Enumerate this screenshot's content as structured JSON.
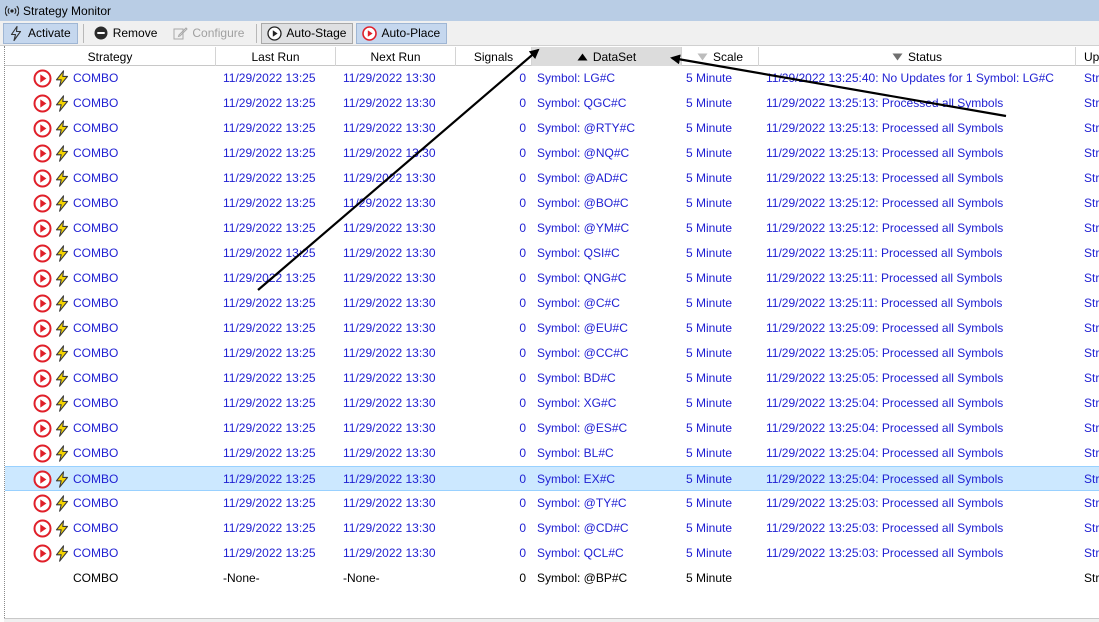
{
  "window": {
    "title": "Strategy Monitor"
  },
  "toolbar": {
    "activate": "Activate",
    "remove": "Remove",
    "configure": "Configure",
    "auto_stage": "Auto-Stage",
    "auto_place": "Auto-Place"
  },
  "columns": {
    "strategy": "Strategy",
    "last_run": "Last Run",
    "next_run": "Next Run",
    "signals": "Signals",
    "dataset": "DataSet",
    "scale": "Scale",
    "status": "Status",
    "up": "Up"
  },
  "rows": [
    {
      "strategy": "COMBO",
      "last_run": "11/29/2022 13:25",
      "next_run": "11/29/2022 13:30",
      "signals": "0",
      "dataset": "Symbol: LG#C",
      "scale": "5 Minute",
      "status": "11/29/2022 13:25:40: No Updates for 1 Symbol: LG#C",
      "up": "Str"
    },
    {
      "strategy": "COMBO",
      "last_run": "11/29/2022 13:25",
      "next_run": "11/29/2022 13:30",
      "signals": "0",
      "dataset": "Symbol: QGC#C",
      "scale": "5 Minute",
      "status": "11/29/2022 13:25:13: Processed all Symbols",
      "up": "Str"
    },
    {
      "strategy": "COMBO",
      "last_run": "11/29/2022 13:25",
      "next_run": "11/29/2022 13:30",
      "signals": "0",
      "dataset": "Symbol: @RTY#C",
      "scale": "5 Minute",
      "status": "11/29/2022 13:25:13: Processed all Symbols",
      "up": "Str"
    },
    {
      "strategy": "COMBO",
      "last_run": "11/29/2022 13:25",
      "next_run": "11/29/2022 13:30",
      "signals": "0",
      "dataset": "Symbol: @NQ#C",
      "scale": "5 Minute",
      "status": "11/29/2022 13:25:13: Processed all Symbols",
      "up": "Str"
    },
    {
      "strategy": "COMBO",
      "last_run": "11/29/2022 13:25",
      "next_run": "11/29/2022 13:30",
      "signals": "0",
      "dataset": "Symbol: @AD#C",
      "scale": "5 Minute",
      "status": "11/29/2022 13:25:13: Processed all Symbols",
      "up": "Str"
    },
    {
      "strategy": "COMBO",
      "last_run": "11/29/2022 13:25",
      "next_run": "11/29/2022 13:30",
      "signals": "0",
      "dataset": "Symbol: @BO#C",
      "scale": "5 Minute",
      "status": "11/29/2022 13:25:12: Processed all Symbols",
      "up": "Str"
    },
    {
      "strategy": "COMBO",
      "last_run": "11/29/2022 13:25",
      "next_run": "11/29/2022 13:30",
      "signals": "0",
      "dataset": "Symbol: @YM#C",
      "scale": "5 Minute",
      "status": "11/29/2022 13:25:12: Processed all Symbols",
      "up": "Str"
    },
    {
      "strategy": "COMBO",
      "last_run": "11/29/2022 13:25",
      "next_run": "11/29/2022 13:30",
      "signals": "0",
      "dataset": "Symbol: QSI#C",
      "scale": "5 Minute",
      "status": "11/29/2022 13:25:11: Processed all Symbols",
      "up": "Str"
    },
    {
      "strategy": "COMBO",
      "last_run": "11/29/2022 13:25",
      "next_run": "11/29/2022 13:30",
      "signals": "0",
      "dataset": "Symbol: QNG#C",
      "scale": "5 Minute",
      "status": "11/29/2022 13:25:11: Processed all Symbols",
      "up": "Str"
    },
    {
      "strategy": "COMBO",
      "last_run": "11/29/2022 13:25",
      "next_run": "11/29/2022 13:30",
      "signals": "0",
      "dataset": "Symbol: @C#C",
      "scale": "5 Minute",
      "status": "11/29/2022 13:25:11: Processed all Symbols",
      "up": "Str"
    },
    {
      "strategy": "COMBO",
      "last_run": "11/29/2022 13:25",
      "next_run": "11/29/2022 13:30",
      "signals": "0",
      "dataset": "Symbol: @EU#C",
      "scale": "5 Minute",
      "status": "11/29/2022 13:25:09: Processed all Symbols",
      "up": "Str"
    },
    {
      "strategy": "COMBO",
      "last_run": "11/29/2022 13:25",
      "next_run": "11/29/2022 13:30",
      "signals": "0",
      "dataset": "Symbol: @CC#C",
      "scale": "5 Minute",
      "status": "11/29/2022 13:25:05: Processed all Symbols",
      "up": "Str"
    },
    {
      "strategy": "COMBO",
      "last_run": "11/29/2022 13:25",
      "next_run": "11/29/2022 13:30",
      "signals": "0",
      "dataset": "Symbol: BD#C",
      "scale": "5 Minute",
      "status": "11/29/2022 13:25:05: Processed all Symbols",
      "up": "Str"
    },
    {
      "strategy": "COMBO",
      "last_run": "11/29/2022 13:25",
      "next_run": "11/29/2022 13:30",
      "signals": "0",
      "dataset": "Symbol: XG#C",
      "scale": "5 Minute",
      "status": "11/29/2022 13:25:04: Processed all Symbols",
      "up": "Str"
    },
    {
      "strategy": "COMBO",
      "last_run": "11/29/2022 13:25",
      "next_run": "11/29/2022 13:30",
      "signals": "0",
      "dataset": "Symbol: @ES#C",
      "scale": "5 Minute",
      "status": "11/29/2022 13:25:04: Processed all Symbols",
      "up": "Str"
    },
    {
      "strategy": "COMBO",
      "last_run": "11/29/2022 13:25",
      "next_run": "11/29/2022 13:30",
      "signals": "0",
      "dataset": "Symbol: BL#C",
      "scale": "5 Minute",
      "status": "11/29/2022 13:25:04: Processed all Symbols",
      "up": "Str"
    },
    {
      "strategy": "COMBO",
      "last_run": "11/29/2022 13:25",
      "next_run": "11/29/2022 13:30",
      "signals": "0",
      "dataset": "Symbol: EX#C",
      "scale": "5 Minute",
      "status": "11/29/2022 13:25:04: Processed all Symbols",
      "up": "Str"
    },
    {
      "strategy": "COMBO",
      "last_run": "11/29/2022 13:25",
      "next_run": "11/29/2022 13:30",
      "signals": "0",
      "dataset": "Symbol: @TY#C",
      "scale": "5 Minute",
      "status": "11/29/2022 13:25:03: Processed all Symbols",
      "up": "Str"
    },
    {
      "strategy": "COMBO",
      "last_run": "11/29/2022 13:25",
      "next_run": "11/29/2022 13:30",
      "signals": "0",
      "dataset": "Symbol: @CD#C",
      "scale": "5 Minute",
      "status": "11/29/2022 13:25:03: Processed all Symbols",
      "up": "Str"
    },
    {
      "strategy": "COMBO",
      "last_run": "11/29/2022 13:25",
      "next_run": "11/29/2022 13:30",
      "signals": "0",
      "dataset": "Symbol: QCL#C",
      "scale": "5 Minute",
      "status": "11/29/2022 13:25:03: Processed all Symbols",
      "up": "Str"
    },
    {
      "strategy": "COMBO",
      "last_run": "-None-",
      "next_run": "-None-",
      "signals": "0",
      "dataset": "Symbol: @BP#C",
      "scale": "5 Minute",
      "status": "",
      "up": "Str"
    }
  ],
  "selected_row": 16,
  "idle_row": 20,
  "colors": {
    "link_text": "#1e1ed2",
    "selection": "#cce8ff",
    "play_icon": "#e0202a",
    "bolt_icon": "#f5d400"
  },
  "icons": {
    "title": "broadcast-icon",
    "activate": "lightning-icon",
    "remove": "remove-icon",
    "configure": "configure-icon",
    "auto_stage": "play-icon",
    "auto_place": "play-red-icon",
    "row_status": "play-red-icon",
    "row_type": "lightning-icon"
  }
}
